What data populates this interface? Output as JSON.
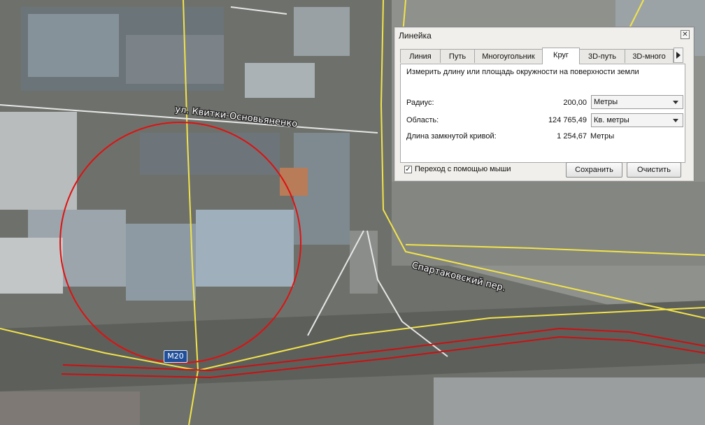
{
  "map": {
    "road_labels": {
      "street_north": "ул. Квитки-Основьяненко",
      "street_east": "Спартаковский пер."
    },
    "route_shield": "М20",
    "colors": {
      "measure_circle": "#e01010",
      "road_line": "#f2e34a",
      "route_line": "#cc1010",
      "path_line": "#eeeeee"
    }
  },
  "ruler": {
    "title": "Линейка",
    "close_icon": "close-icon",
    "tabs": [
      {
        "label": "Линия",
        "active": false
      },
      {
        "label": "Путь",
        "active": false
      },
      {
        "label": "Многоугольник",
        "active": false
      },
      {
        "label": "Круг",
        "active": true
      },
      {
        "label": "3D-путь",
        "active": false
      },
      {
        "label": "3D-много",
        "active": false
      }
    ],
    "description": "Измерить длину или площадь окружности на поверхности земли",
    "radius": {
      "label": "Радиус:",
      "value": "200,00",
      "unit": "Метры"
    },
    "area": {
      "label": "Область:",
      "value": "124 765,49",
      "unit": "Кв. метры"
    },
    "circumference": {
      "label": "Длина замкнутой кривой:",
      "value": "1 254,67",
      "unit": "Метры"
    },
    "mouse_nav": {
      "label": "Переход с помощью мыши",
      "checked": "✓"
    },
    "save_button": "Сохранить",
    "clear_button": "Очистить"
  }
}
